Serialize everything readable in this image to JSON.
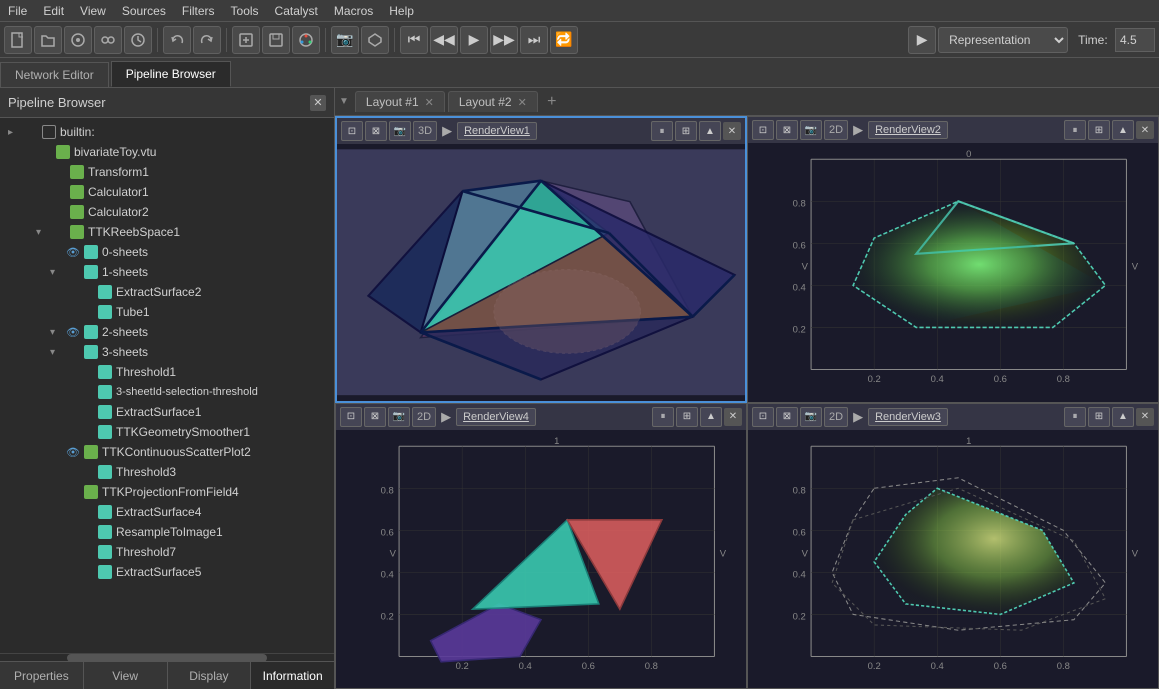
{
  "menubar": {
    "items": [
      "File",
      "Edit",
      "View",
      "Sources",
      "Filters",
      "Tools",
      "Catalyst",
      "Macros",
      "Help"
    ]
  },
  "toolbar": {
    "representation_label": "Representation",
    "time_label": "Time:",
    "time_value": "4.5"
  },
  "tabs": {
    "network_editor": "Network Editor",
    "pipeline_browser": "Pipeline Browser"
  },
  "pipeline": {
    "title": "Pipeline Browser",
    "nodes": [
      {
        "id": "builtin",
        "label": "builtin:",
        "indent": 1,
        "icon": "folder",
        "expand": "▸",
        "visible": false
      },
      {
        "id": "bivariate",
        "label": "bivariateToy.vtu",
        "indent": 2,
        "icon": "green",
        "expand": "",
        "visible": false
      },
      {
        "id": "transform1",
        "label": "Transform1",
        "indent": 3,
        "icon": "green",
        "expand": "",
        "visible": false
      },
      {
        "id": "calculator1",
        "label": "Calculator1",
        "indent": 3,
        "icon": "green",
        "expand": "",
        "visible": false
      },
      {
        "id": "calculator2",
        "label": "Calculator2",
        "indent": 3,
        "icon": "green",
        "expand": "",
        "visible": false
      },
      {
        "id": "ttkreebspace1",
        "label": "TTKReebSpace1",
        "indent": 3,
        "icon": "green",
        "expand": "▾",
        "visible": false
      },
      {
        "id": "0sheets",
        "label": "0-sheets",
        "indent": 4,
        "icon": "teal",
        "expand": "",
        "visible": true
      },
      {
        "id": "1sheets",
        "label": "1-sheets",
        "indent": 4,
        "icon": "teal",
        "expand": "▾",
        "visible": false
      },
      {
        "id": "extractsurface2",
        "label": "ExtractSurface2",
        "indent": 5,
        "icon": "teal",
        "expand": "",
        "visible": false
      },
      {
        "id": "tube1",
        "label": "Tube1",
        "indent": 5,
        "icon": "teal",
        "expand": "",
        "visible": false
      },
      {
        "id": "2sheets",
        "label": "2-sheets",
        "indent": 4,
        "icon": "teal",
        "expand": "▾",
        "visible": true
      },
      {
        "id": "3sheets",
        "label": "3-sheets",
        "indent": 4,
        "icon": "teal",
        "expand": "▾",
        "visible": false
      },
      {
        "id": "threshold1",
        "label": "Threshold1",
        "indent": 5,
        "icon": "teal",
        "expand": "",
        "visible": false
      },
      {
        "id": "3sheetid",
        "label": "3-sheetId-selection-threshold",
        "indent": 5,
        "icon": "teal",
        "expand": "",
        "visible": false
      },
      {
        "id": "extractsurface1",
        "label": "ExtractSurface1",
        "indent": 5,
        "icon": "teal",
        "expand": "",
        "visible": false
      },
      {
        "id": "ttkgeometrysmoother1",
        "label": "TTKGeometrySmoother1",
        "indent": 5,
        "icon": "teal",
        "expand": "",
        "visible": false
      },
      {
        "id": "ttkcontinuousscatterplot2",
        "label": "TTKContinuousScatterPlot2",
        "indent": 4,
        "icon": "green",
        "expand": "",
        "visible": true
      },
      {
        "id": "threshold3",
        "label": "Threshold3",
        "indent": 5,
        "icon": "teal",
        "expand": "",
        "visible": false
      },
      {
        "id": "ttkprojectionfromfield4",
        "label": "TTKProjectionFromField4",
        "indent": 4,
        "icon": "green",
        "expand": "",
        "visible": false
      },
      {
        "id": "extractsurface4",
        "label": "ExtractSurface4",
        "indent": 5,
        "icon": "teal",
        "expand": "",
        "visible": false
      },
      {
        "id": "resampletoimage1",
        "label": "ResampleToImage1",
        "indent": 5,
        "icon": "teal",
        "expand": "",
        "visible": false
      },
      {
        "id": "threshold7",
        "label": "Threshold7",
        "indent": 5,
        "icon": "teal",
        "expand": "",
        "visible": false
      },
      {
        "id": "extractsurface5",
        "label": "ExtractSurface5",
        "indent": 5,
        "icon": "teal",
        "expand": "",
        "visible": false
      }
    ]
  },
  "layout_tabs": [
    {
      "label": "Layout #1",
      "closeable": true
    },
    {
      "label": "Layout #2",
      "closeable": true
    }
  ],
  "render_views": [
    {
      "id": "rv1",
      "dim": "3D",
      "name": "RenderView1",
      "active": true,
      "position": "top-left"
    },
    {
      "id": "rv2",
      "dim": "2D",
      "name": "RenderView2",
      "active": false,
      "position": "top-right"
    },
    {
      "id": "rv4",
      "dim": "2D",
      "name": "RenderView4",
      "active": false,
      "position": "bottom-left"
    },
    {
      "id": "rv3",
      "dim": "2D",
      "name": "RenderView3",
      "active": false,
      "position": "bottom-right"
    }
  ],
  "bottom_tabs": {
    "properties": "Properties",
    "view": "View",
    "display": "Display",
    "information": "Information"
  },
  "icons": {
    "eye": "👁",
    "close": "✕",
    "plus": "+",
    "chevron_right": "▶",
    "chevron_down": "▼",
    "pause": "⏸",
    "grid": "⊞",
    "up": "▲",
    "down": "▼",
    "camera": "📷",
    "zoom": "🔍"
  }
}
